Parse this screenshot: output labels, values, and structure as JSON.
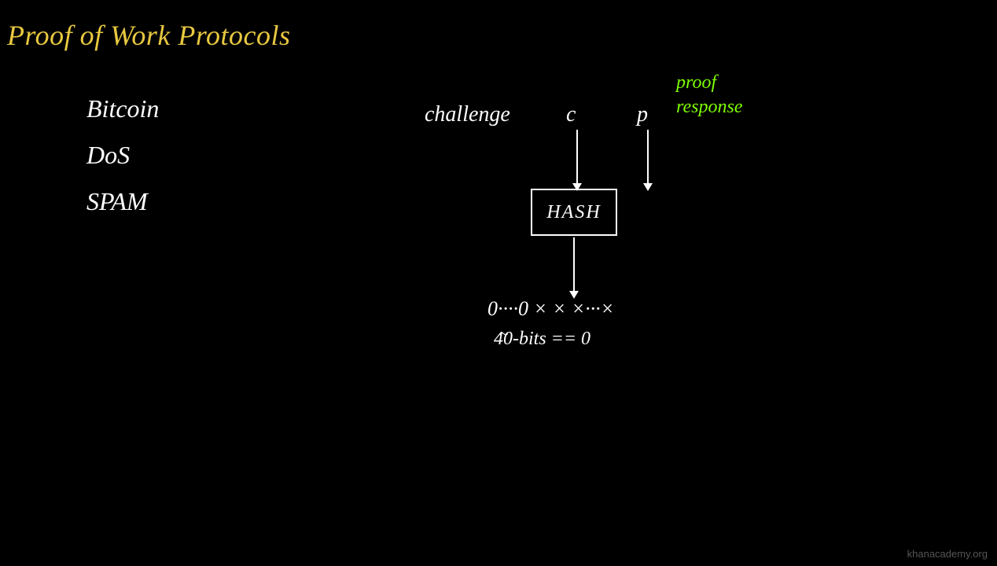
{
  "title": "Proof of Work Protocols",
  "left_items": [
    {
      "label": "Bitcoin"
    },
    {
      "label": "DoS"
    },
    {
      "label": "SPAM"
    }
  ],
  "diagram": {
    "challenge_label": "challenge",
    "c_label": "c",
    "p_label": "p",
    "proof_label": "proof\nresponse",
    "hash_label": "HASH",
    "hash_output": "0····0 × × ×···×",
    "bits_label": "40-bits == 0",
    "tilde": "~"
  },
  "watermark": "khanacademy.org"
}
